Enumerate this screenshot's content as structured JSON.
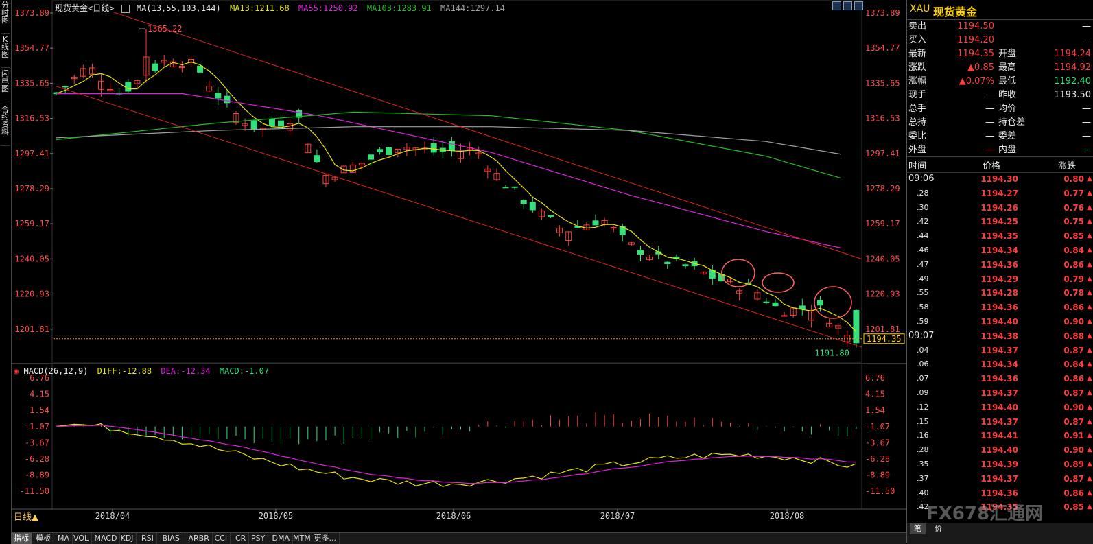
{
  "left_tabs": [
    "分时图",
    "K线图",
    "闪电图",
    "合约资料"
  ],
  "main": {
    "title": "现货黄金<日线>",
    "ma_label": "MA(13,55,103,144)",
    "ma13": "MA13:1211.68",
    "ma55": "MA55:1250.92",
    "ma103": "MA103:1283.91",
    "ma144": "MA144:1297.14",
    "high_label": "1365.22",
    "low_label": "1191.80",
    "current_price": "1194.35",
    "price_ticks": [
      "1373.89",
      "1354.77",
      "1335.65",
      "1316.53",
      "1297.41",
      "1278.29",
      "1259.17",
      "1240.05",
      "1220.93",
      "1201.81"
    ],
    "date_labels": [
      "2018/04",
      "2018/05",
      "2018/06",
      "2018/07",
      "2018/08"
    ],
    "period": "日线▲"
  },
  "macd": {
    "label": "MACD(26,12,9)",
    "diff": "DIFF:-12.88",
    "dea": "DEA:-12.34",
    "macd": "MACD:-1.07",
    "ticks": [
      "6.76",
      "4.15",
      "1.54",
      "-1.07",
      "-3.67",
      "-6.28",
      "-8.89",
      "-11.50"
    ]
  },
  "bottom_tabs": [
    "指标",
    "模板",
    "MA",
    "VOL",
    "MACD",
    "KDJ",
    "RSI",
    "BIAS",
    "ARBR",
    "CCI",
    "CR",
    "PSY",
    "DMA",
    "MTM",
    "更多..."
  ],
  "right": {
    "code": "XAU",
    "name": "现货黄金",
    "quote_rows": [
      {
        "l1": "卖出",
        "v1": "1194.50",
        "c1": "red",
        "l2": "",
        "v2": "—",
        "c2": "wht"
      },
      {
        "l1": "买入",
        "v1": "1194.20",
        "c1": "red",
        "l2": "",
        "v2": "—",
        "c2": "wht"
      },
      {
        "l1": "最新",
        "v1": "1194.35",
        "c1": "red",
        "l2": "开盘",
        "v2": "1194.24",
        "c2": "red"
      },
      {
        "l1": "涨跌",
        "v1": "▲0.85",
        "c1": "red",
        "l2": "最高",
        "v2": "1194.92",
        "c2": "red"
      },
      {
        "l1": "涨幅",
        "v1": "▲0.07%",
        "c1": "red",
        "l2": "最低",
        "v2": "1192.40",
        "c2": "grn"
      },
      {
        "l1": "现手",
        "v1": "—",
        "c1": "wht",
        "l2": "昨收",
        "v2": "1193.50",
        "c2": "wht"
      },
      {
        "l1": "总手",
        "v1": "—",
        "c1": "wht",
        "l2": "均价",
        "v2": "—",
        "c2": "wht"
      },
      {
        "l1": "总持",
        "v1": "—",
        "c1": "wht",
        "l2": "持仓差",
        "v2": "—",
        "c2": "wht"
      },
      {
        "l1": "委比",
        "v1": "—",
        "c1": "wht",
        "l2": "委差",
        "v2": "—",
        "c2": "wht"
      },
      {
        "l1": "外盘",
        "v1": "—",
        "c1": "red",
        "l2": "内盘",
        "v2": "—",
        "c2": "grn"
      }
    ],
    "tick_headers": [
      "时间",
      "价格",
      "涨跌"
    ],
    "ticks": [
      {
        "t": "09:06",
        "p": "1194.30",
        "c": "0.80"
      },
      {
        "t": ".28",
        "p": "1194.27",
        "c": "0.77"
      },
      {
        "t": ".30",
        "p": "1194.26",
        "c": "0.76"
      },
      {
        "t": ".42",
        "p": "1194.25",
        "c": "0.75"
      },
      {
        "t": ".44",
        "p": "1194.35",
        "c": "0.85"
      },
      {
        "t": ".46",
        "p": "1194.34",
        "c": "0.84"
      },
      {
        "t": ".47",
        "p": "1194.36",
        "c": "0.86"
      },
      {
        "t": ".49",
        "p": "1194.29",
        "c": "0.79"
      },
      {
        "t": ".55",
        "p": "1194.28",
        "c": "0.78"
      },
      {
        "t": ".58",
        "p": "1194.36",
        "c": "0.86"
      },
      {
        "t": ".59",
        "p": "1194.40",
        "c": "0.90"
      },
      {
        "t": "09:07",
        "p": "1194.38",
        "c": "0.88"
      },
      {
        "t": ".04",
        "p": "1194.37",
        "c": "0.87"
      },
      {
        "t": ".06",
        "p": "1194.34",
        "c": "0.84"
      },
      {
        "t": ".07",
        "p": "1194.36",
        "c": "0.86"
      },
      {
        "t": ".09",
        "p": "1194.37",
        "c": "0.87"
      },
      {
        "t": ".12",
        "p": "1194.40",
        "c": "0.90"
      },
      {
        "t": ".15",
        "p": "1194.37",
        "c": "0.87"
      },
      {
        "t": ".16",
        "p": "1194.41",
        "c": "0.91"
      },
      {
        "t": ".28",
        "p": "1194.40",
        "c": "0.90"
      },
      {
        "t": ".35",
        "p": "1194.39",
        "c": "0.89"
      },
      {
        "t": ".37",
        "p": "1194.37",
        "c": "0.87"
      },
      {
        "t": ".40",
        "p": "1194.36",
        "c": "0.86"
      },
      {
        "t": ".42",
        "p": "1194.35",
        "c": "0.85"
      }
    ],
    "bottom_tabs": [
      "笔",
      "价"
    ],
    "watermark": "FX678汇通网"
  },
  "colors": {
    "up": "#ff3c3c",
    "down": "#33e07a",
    "ma13": "#e8e800",
    "ma55": "#e020e0",
    "ma103": "#20c020",
    "ma144": "#a0a0a0",
    "trend": "#e02020"
  }
}
